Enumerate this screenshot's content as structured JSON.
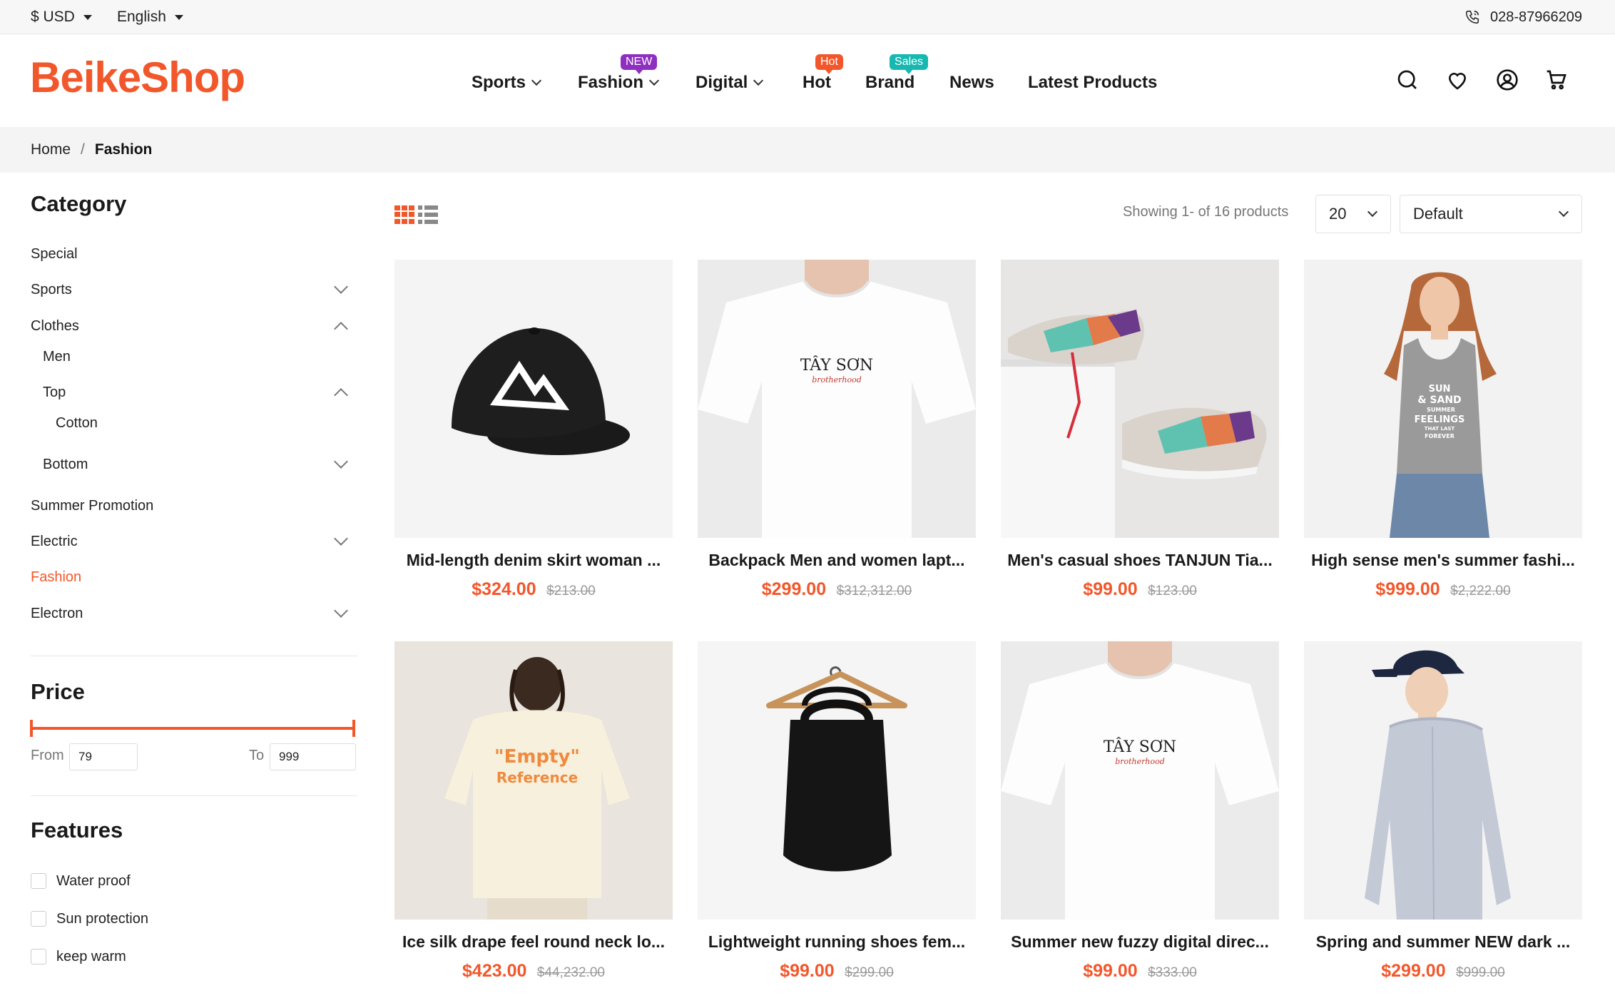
{
  "colors": {
    "accent": "#f2572b",
    "badge_new": "#8e2fbf",
    "badge_hot": "#f2572b",
    "badge_sales": "#17b8b0"
  },
  "topbar": {
    "currency": "$ USD",
    "language": "English",
    "phone": "028-87966209"
  },
  "header": {
    "logo": "BeikeShop",
    "nav": [
      {
        "label": "Sports",
        "has_dropdown": true,
        "badge": ""
      },
      {
        "label": "Fashion",
        "has_dropdown": true,
        "badge": "NEW"
      },
      {
        "label": "Digital",
        "has_dropdown": true,
        "badge": ""
      },
      {
        "label": "Hot",
        "has_dropdown": false,
        "badge": "Hot"
      },
      {
        "label": "Brand",
        "has_dropdown": false,
        "badge": "Sales"
      },
      {
        "label": "News",
        "has_dropdown": false,
        "badge": ""
      },
      {
        "label": "Latest Products",
        "has_dropdown": false,
        "badge": ""
      }
    ],
    "icons": [
      "search-icon",
      "heart-icon",
      "account-icon",
      "cart-icon"
    ]
  },
  "breadcrumb": {
    "home": "Home",
    "separator": "/",
    "current": "Fashion"
  },
  "sidebar": {
    "category_title": "Category",
    "categories": [
      {
        "label": "Special",
        "state": "none",
        "level": 0
      },
      {
        "label": "Sports",
        "state": "collapsed",
        "level": 0
      },
      {
        "label": "Clothes",
        "state": "expanded",
        "level": 0
      },
      {
        "label": "Men",
        "state": "none",
        "level": 1
      },
      {
        "label": "Top",
        "state": "expanded",
        "level": 1
      },
      {
        "label": "Cotton",
        "state": "none",
        "level": 2
      },
      {
        "label": "Bottom",
        "state": "collapsed",
        "level": 1
      },
      {
        "label": "Summer Promotion",
        "state": "none",
        "level": 0
      },
      {
        "label": "Electric",
        "state": "collapsed",
        "level": 0
      },
      {
        "label": "Fashion",
        "state": "active",
        "level": 0
      },
      {
        "label": "Electron",
        "state": "collapsed",
        "level": 0
      }
    ],
    "price": {
      "title": "Price",
      "from_label": "From",
      "from_value": "79",
      "to_label": "To",
      "to_value": "999"
    },
    "features": {
      "title": "Features",
      "items": [
        "Water proof",
        "Sun protection",
        "keep warm"
      ]
    }
  },
  "toolbar": {
    "showing": "Showing 1- of 16 products",
    "per_page": "20",
    "sort": "Default"
  },
  "products": [
    {
      "title": "Mid-length denim skirt woman ...",
      "price": "$324.00",
      "old_price": "$213.00",
      "image": "black-cap-image"
    },
    {
      "title": "Backpack Men and women lapt...",
      "price": "$299.00",
      "old_price": "$312,312.00",
      "image": "white-tshirt-image"
    },
    {
      "title": "Men's casual shoes TANJUN Tia...",
      "price": "$99.00",
      "old_price": "$123.00",
      "image": "sneakers-image"
    },
    {
      "title": "High sense men's summer fashi...",
      "price": "$999.00",
      "old_price": "$2,222.00",
      "image": "tank-top-image"
    },
    {
      "title": "Ice silk drape feel round neck lo...",
      "price": "$423.00",
      "old_price": "$44,232.00",
      "image": "back-print-tshirt-image"
    },
    {
      "title": "Lightweight running shoes fem...",
      "price": "$99.00",
      "old_price": "$299.00",
      "image": "tote-bag-image"
    },
    {
      "title": "Summer new fuzzy digital direc...",
      "price": "$99.00",
      "old_price": "$333.00",
      "image": "white-tshirt-image"
    },
    {
      "title": "Spring and summer NEW dark ...",
      "price": "$299.00",
      "old_price": "$999.00",
      "image": "shirt-cap-image"
    }
  ],
  "product_art": {
    "tshirt_brand": "TÂY SƠN",
    "tshirt_sub": "brotherhood",
    "tank_text": [
      "SUN",
      "& SAND",
      "SUMMER",
      "FEELINGS",
      "THAT LAST",
      "FOREVER"
    ],
    "back_print": [
      "\"Empty\"",
      "Reference"
    ]
  }
}
